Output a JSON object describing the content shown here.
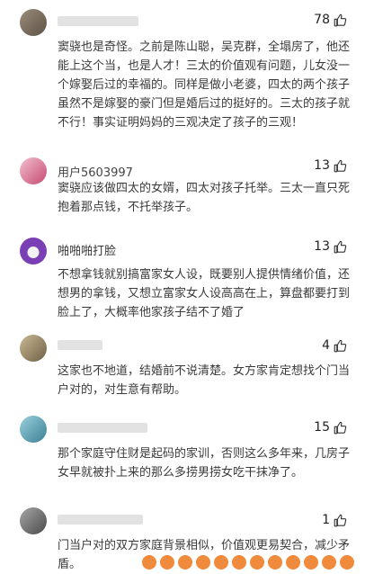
{
  "comments": [
    {
      "user": "",
      "likes": "78",
      "text": "窦骁也是奇怪。之前是陈山聪，吴克群，全塌房了，他还能上这个当，也是人才！三太的价值观有问题，儿女没一个嫁娶后过的幸福的。同样是做小老婆，四太的两个孩子虽然不是嫁娶的豪门但是婚后过的挺好的。三太的孩子就不行！事实证明妈妈的三观决定了孩子的三观！",
      "avatar_color": "#7a6a5a"
    },
    {
      "user": "用户5603997",
      "likes": "13",
      "text": "窦骁应该做四太的女婿，四太对孩子托举。三太一直只死抱着那点钱，不托举孩子。",
      "avatar_color": "#d4577a"
    },
    {
      "user": "啪啪啪打脸",
      "likes": "13",
      "text": "不想拿钱就别搞富家女人设，既要别人提供情绪价值，还想男的拿钱，又想立富家女人设高高在上，算盘都要打到脸上了，大概率他家孩子结不了婚了",
      "avatar_color": "#7b3fb5"
    },
    {
      "user": "",
      "likes": "4",
      "text": "这家也不地道，结婚前不说清楚。女方家肯定想找个门当户对的，对生意有帮助。",
      "avatar_color": "#8c7a5a"
    },
    {
      "user": "",
      "likes": "15",
      "text": "那个家庭守住财是起码的家训，否则这么多年来，几房子女早就被扑上来的那么多捞男捞女吃干抹净了。",
      "avatar_color": "#5aa8b8"
    },
    {
      "user": "",
      "likes": "1",
      "text": "门当户对的双方家庭背景相似，价值观更易契合，减少矛盾。",
      "avatar_color": "#6a6a6a"
    }
  ],
  "colors": {
    "text": "#3a3a3a",
    "thumb": "#333333",
    "emoji": "#f08a3c"
  },
  "icons": {
    "like": "thumbs-up-icon"
  }
}
